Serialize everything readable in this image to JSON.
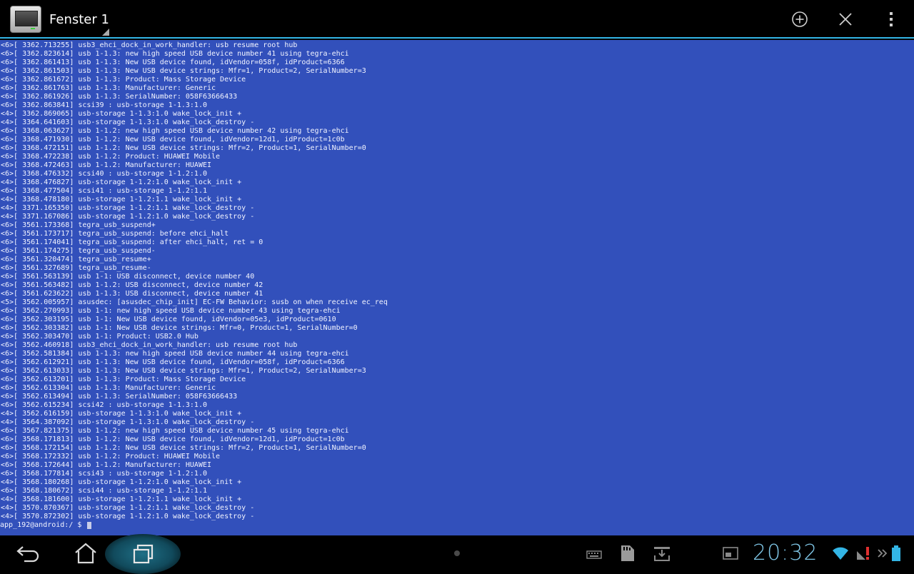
{
  "window": {
    "title": "Fenster 1",
    "app_icon": "terminal-app-icon"
  },
  "actions": [
    {
      "name": "add-window-button",
      "icon": "plus-circle-icon"
    },
    {
      "name": "close-window-button",
      "icon": "close-icon"
    },
    {
      "name": "overflow-menu-button",
      "icon": "overflow-icon"
    }
  ],
  "terminal": {
    "background": "#3250bb",
    "lines": [
      "<6>[ 3362.713255] usb3_ehci_dock_in_work_handler: usb resume root hub",
      "<6>[ 3362.823614] usb 1-1.3: new high speed USB device number 41 using tegra-ehci",
      "<6>[ 3362.861413] usb 1-1.3: New USB device found, idVendor=058f, idProduct=6366",
      "<6>[ 3362.861503] usb 1-1.3: New USB device strings: Mfr=1, Product=2, SerialNumber=3",
      "<6>[ 3362.861672] usb 1-1.3: Product: Mass Storage Device",
      "<6>[ 3362.861763] usb 1-1.3: Manufacturer: Generic",
      "<6>[ 3362.861926] usb 1-1.3: SerialNumber: 058F63666433",
      "<6>[ 3362.863841] scsi39 : usb-storage 1-1.3:1.0",
      "<4>[ 3362.869065] usb-storage 1-1.3:1.0 wake_lock_init +",
      "<4>[ 3364.641603] usb-storage 1-1.3:1.0 wake_lock_destroy -",
      "<6>[ 3368.063627] usb 1-1.2: new high speed USB device number 42 using tegra-ehci",
      "<6>[ 3368.471930] usb 1-1.2: New USB device found, idVendor=12d1, idProduct=1c0b",
      "<6>[ 3368.472151] usb 1-1.2: New USB device strings: Mfr=2, Product=1, SerialNumber=0",
      "<6>[ 3368.472238] usb 1-1.2: Product: HUAWEI Mobile",
      "<6>[ 3368.472463] usb 1-1.2: Manufacturer: HUAWEI",
      "<6>[ 3368.476332] scsi40 : usb-storage 1-1.2:1.0",
      "<4>[ 3368.476827] usb-storage 1-1.2:1.0 wake_lock_init +",
      "<6>[ 3368.477504] scsi41 : usb-storage 1-1.2:1.1",
      "<4>[ 3368.478180] usb-storage 1-1.2:1.1 wake_lock_init +",
      "<4>[ 3371.165350] usb-storage 1-1.2:1.1 wake_lock_destroy -",
      "<4>[ 3371.167086] usb-storage 1-1.2:1.0 wake_lock_destroy -",
      "<6>[ 3561.173368] tegra_usb_suspend+",
      "<6>[ 3561.173717] tegra_usb_suspend: before ehci_halt",
      "<6>[ 3561.174041] tegra_usb_suspend: after ehci_halt, ret = 0",
      "<6>[ 3561.174275] tegra_usb_suspend-",
      "<6>[ 3561.320474] tegra_usb_resume+",
      "<6>[ 3561.327689] tegra_usb_resume-",
      "<6>[ 3561.563139] usb 1-1: USB disconnect, device number 40",
      "<6>[ 3561.563482] usb 1-1.2: USB disconnect, device number 42",
      "<6>[ 3561.623622] usb 1-1.3: USB disconnect, device number 41",
      "<5>[ 3562.005957] asusdec: [asusdec_chip_init] EC-FW Behavior: susb on when receive ec_req",
      "<6>[ 3562.270993] usb 1-1: new high speed USB device number 43 using tegra-ehci",
      "<6>[ 3562.303195] usb 1-1: New USB device found, idVendor=05e3, idProduct=0610",
      "<6>[ 3562.303382] usb 1-1: New USB device strings: Mfr=0, Product=1, SerialNumber=0",
      "<6>[ 3562.303470] usb 1-1: Product: USB2.0 Hub",
      "<6>[ 3562.460918] usb3_ehci_dock_in_work_handler: usb resume root hub",
      "<6>[ 3562.581384] usb 1-1.3: new high speed USB device number 44 using tegra-ehci",
      "<6>[ 3562.612921] usb 1-1.3: New USB device found, idVendor=058f, idProduct=6366",
      "<6>[ 3562.613033] usb 1-1.3: New USB device strings: Mfr=1, Product=2, SerialNumber=3",
      "<6>[ 3562.613201] usb 1-1.3: Product: Mass Storage Device",
      "<6>[ 3562.613304] usb 1-1.3: Manufacturer: Generic",
      "<6>[ 3562.613494] usb 1-1.3: SerialNumber: 058F63666433",
      "<6>[ 3562.615234] scsi42 : usb-storage 1-1.3:1.0",
      "<4>[ 3562.616159] usb-storage 1-1.3:1.0 wake_lock_init +",
      "<4>[ 3564.387092] usb-storage 1-1.3:1.0 wake_lock_destroy -",
      "<6>[ 3567.821375] usb 1-1.2: new high speed USB device number 45 using tegra-ehci",
      "<6>[ 3568.171813] usb 1-1.2: New USB device found, idVendor=12d1, idProduct=1c0b",
      "<6>[ 3568.172154] usb 1-1.2: New USB device strings: Mfr=2, Product=1, SerialNumber=0",
      "<6>[ 3568.172332] usb 1-1.2: Product: HUAWEI Mobile",
      "<6>[ 3568.172644] usb 1-1.2: Manufacturer: HUAWEI",
      "<6>[ 3568.177814] scsi43 : usb-storage 1-1.2:1.0",
      "<4>[ 3568.180268] usb-storage 1-1.2:1.0 wake_lock_init +",
      "<6>[ 3568.180672] scsi44 : usb-storage 1-1.2:1.1",
      "<4>[ 3568.181600] usb-storage 1-1.2:1.1 wake_lock_init +",
      "<4>[ 3570.870367] usb-storage 1-1.2:1.1 wake_lock_destroy -",
      "<4>[ 3570.872302] usb-storage 1-1.2:1.0 wake_lock_destroy -"
    ],
    "prompt": "app_192@android:/ $ "
  },
  "systembar": {
    "nav": [
      "back-icon",
      "home-icon",
      "recent-apps-icon"
    ],
    "status_icons": [
      "keyboard-icon",
      "sd-card-icon",
      "download-icon",
      "screenshot-icon",
      "wifi-icon",
      "alert-icon",
      "more-icon",
      "battery-icon"
    ],
    "clock": "20:32",
    "accent_color": "#33b5e5"
  }
}
